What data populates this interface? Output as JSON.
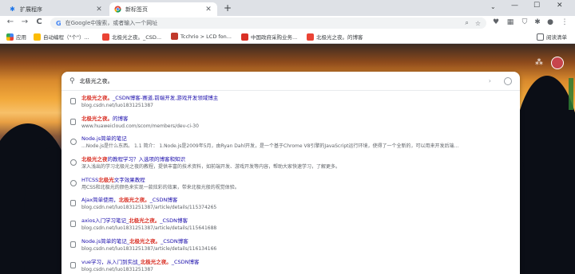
{
  "tabs": [
    {
      "title": "扩展程序",
      "icon": "puzzle-icon"
    },
    {
      "title": "新标签页",
      "icon": "chrome-icon"
    }
  ],
  "window": {
    "minimize": "—",
    "maximize": "☐",
    "close": "✕",
    "tab_menu": "⌄",
    "new_tab": "+"
  },
  "toolbar": {
    "back": "←",
    "forward": "→",
    "reload": "C",
    "omnibox_placeholder": "在Google中搜索，或者输入一个网址"
  },
  "bookmarks": [
    {
      "label": "应用",
      "color": "#4285f4"
    },
    {
      "label": "自动编程（\"个\"）...",
      "color": "#fbbc05"
    },
    {
      "label": "北极光之夜。_CSD...",
      "color": "#ea4335"
    },
    {
      "label": "Tcchrio > LCD fon...",
      "color": "#c0392b"
    },
    {
      "label": "中国政府采购业务...",
      "color": "#d93025"
    },
    {
      "label": "北极光之夜。的博客",
      "color": "#ea4335"
    },
    {
      "label": "阅读清单",
      "color": "#5f6368"
    }
  ],
  "search": {
    "query": "北极光之夜。"
  },
  "results": [
    {
      "pre": "",
      "hl": "北极光之夜。",
      "post": "_CSDN博客-赛道,前端开发,游戏开发领域博主",
      "url": "blog.csdn.net/luo1831251387"
    },
    {
      "pre": "",
      "hl": "北极光之夜。",
      "post": "的博客",
      "url": "www.huaweicloud.com/scom/members/dev-ci-30"
    },
    {
      "pre": "Node.js简单的笔记",
      "hl": "",
      "post": "",
      "url": "...Node.js是什么东西。 1.1 简介：    1.Node.js是2009年5月，由Ryan Dahl开发，是一个基于Chrome V8引擎的JavaScript运行环境，使得了一个全新的，可以用来开发后端..."
    },
    {
      "pre": "",
      "hl": "北极光之夜",
      "post": "的教程学习？入选项的博客和知识",
      "url": "深入浅出的学习北极光之夜的教程，提供丰富的技术资料，如前端开发、游戏开发等内容，帮助大家快速学习，了解更多。"
    },
    {
      "pre": "HTCSS",
      "hl": "北极光",
      "post": "文字效果教程",
      "url": "用CSS和北极光的颜色来实现一款炫彩的效果，带来北极光般的视觉体验。"
    },
    {
      "pre": "Ajax简单使用，",
      "hl": "北极光之夜。",
      "post": "_CSDN博客",
      "url": "blog.csdn.net/luo1831251387/article/details/115374265"
    },
    {
      "pre": "axios入门学习笔记_",
      "hl": "北极光之夜。",
      "post": "_CSDN博客",
      "url": "blog.csdn.net/luo1831251387/article/details/115641688"
    },
    {
      "pre": "Node.js简单的笔记_",
      "hl": "北极光之夜。",
      "post": "_CSDN博客",
      "url": "blog.csdn.net/luo1831251387/article/details/116134166"
    },
    {
      "pre": "vue学习，从入门到实战_",
      "hl": "北极光之夜。",
      "post": "_CSDN博客",
      "url": "blog.csdn.net/luo1831251387"
    }
  ]
}
